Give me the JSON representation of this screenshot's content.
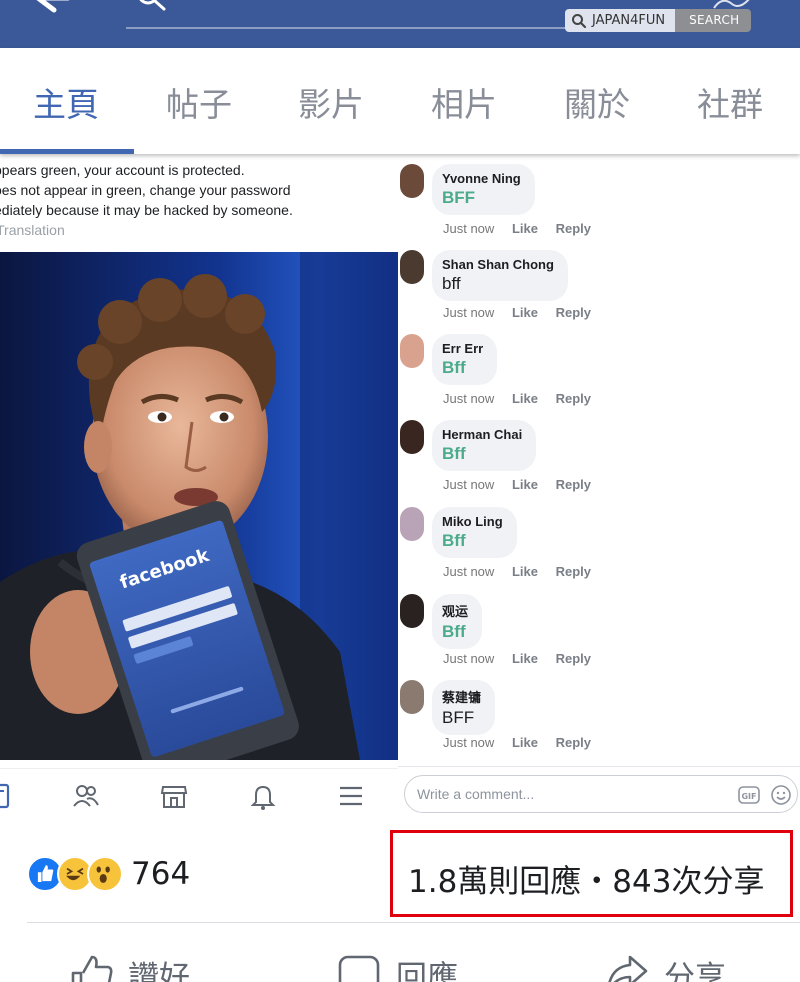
{
  "header": {
    "site_badge": "JAPAN4FUN",
    "search_badge": "SEARCH"
  },
  "tabs": [
    {
      "label": "主頁",
      "active": true
    },
    {
      "label": "帖子",
      "active": false
    },
    {
      "label": "影片",
      "active": false
    },
    {
      "label": "相片",
      "active": false
    },
    {
      "label": "關於",
      "active": false
    },
    {
      "label": "社群",
      "active": false
    }
  ],
  "post": {
    "text_lines": [
      "ppears green, your account is protected.",
      "oes not appear in green, change your password",
      "ediately because it may be hacked by someone."
    ],
    "translation": "Translation",
    "phone_brand": "facebook"
  },
  "comments": [
    {
      "name": "Yvonne Ning",
      "text": "BFF",
      "green": true,
      "time": "Just now",
      "like": "Like",
      "reply": "Reply"
    },
    {
      "name": "Shan Shan Chong",
      "text": "bff",
      "green": false,
      "time": "Just now",
      "like": "Like",
      "reply": "Reply"
    },
    {
      "name": "Err Err",
      "text": "Bff",
      "green": true,
      "time": "Just now",
      "like": "Like",
      "reply": "Reply"
    },
    {
      "name": "Herman Chai",
      "text": "Bff",
      "green": true,
      "time": "Just now",
      "like": "Like",
      "reply": "Reply"
    },
    {
      "name": "Miko Ling",
      "text": "Bff",
      "green": true,
      "time": "Just now",
      "like": "Like",
      "reply": "Reply"
    },
    {
      "name": "观运",
      "text": "Bff",
      "green": true,
      "time": "Just now",
      "like": "Like",
      "reply": "Reply"
    },
    {
      "name": "蔡建镛",
      "text": "BFF",
      "green": false,
      "time": "Just now",
      "like": "Like",
      "reply": "Reply"
    }
  ],
  "comment_input": {
    "placeholder": "Write a comment..."
  },
  "stats": {
    "reaction_count": "764",
    "responses_shares": "1.8萬則回應・843次分享"
  },
  "actions": {
    "like": "讚好",
    "comment": "回應",
    "share": "分享"
  },
  "colors": {
    "brand_blue": "#3b5998",
    "tab_active": "#4267b2",
    "highlight_red": "#e0000b",
    "comment_green": "#4cab8b"
  }
}
